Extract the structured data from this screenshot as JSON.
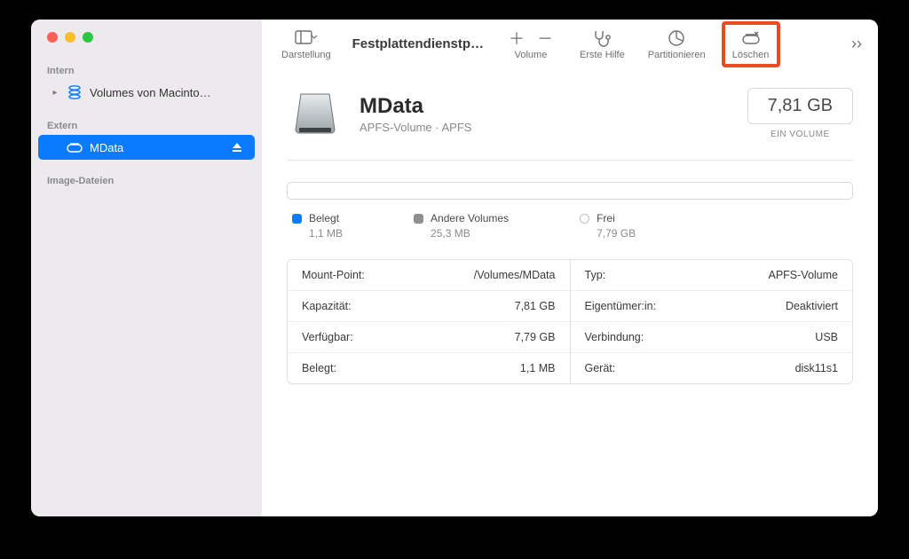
{
  "window_title": "Festplattendienstp…",
  "toolbar": {
    "view_label": "Darstellung",
    "volume_label": "Volume",
    "firstaid_label": "Erste Hilfe",
    "partition_label": "Partitionieren",
    "erase_label": "Löschen"
  },
  "sidebar": {
    "sections": {
      "internal": "Intern",
      "external": "Extern",
      "images": "Image-Dateien"
    },
    "internal_item": "Volumes von Macinto…",
    "external_item": "MData"
  },
  "volume": {
    "name": "MData",
    "subtitle": "APFS-Volume · APFS",
    "size": "7,81 GB",
    "size_caption": "EIN VOLUME"
  },
  "legend": {
    "used_label": "Belegt",
    "used_value": "1,1 MB",
    "other_label": "Andere Volumes",
    "other_value": "25,3 MB",
    "free_label": "Frei",
    "free_value": "7,79 GB"
  },
  "details": {
    "left": [
      {
        "k": "Mount-Point:",
        "v": "/Volumes/MData"
      },
      {
        "k": "Kapazität:",
        "v": "7,81 GB"
      },
      {
        "k": "Verfügbar:",
        "v": "7,79 GB"
      },
      {
        "k": "Belegt:",
        "v": "1,1 MB"
      }
    ],
    "right": [
      {
        "k": "Typ:",
        "v": "APFS-Volume"
      },
      {
        "k": "Eigentümer:in:",
        "v": "Deaktiviert"
      },
      {
        "k": "Verbindung:",
        "v": "USB"
      },
      {
        "k": "Gerät:",
        "v": "disk11s1"
      }
    ]
  }
}
